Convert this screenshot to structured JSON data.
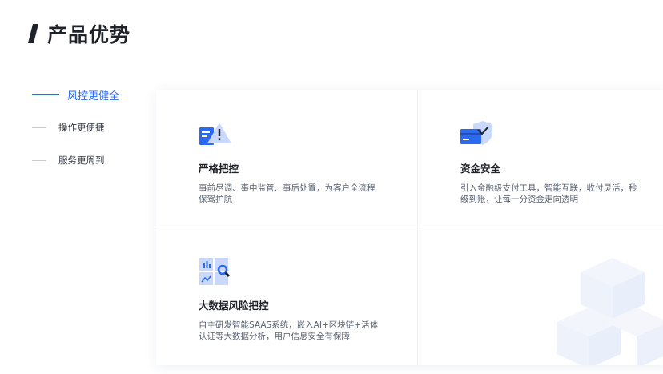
{
  "header": {
    "title": "产品优势"
  },
  "tabs": [
    {
      "label": "风控更健全",
      "active": true
    },
    {
      "label": "操作更便捷",
      "active": false
    },
    {
      "label": "服务更周到",
      "active": false
    }
  ],
  "cards": [
    {
      "icon": "document-warning-icon",
      "title": "严格把控",
      "desc": "事前尽调、事中监管、事后处置，为客户全流程保驾护航"
    },
    {
      "icon": "card-shield-icon",
      "title": "资金安全",
      "desc": "引入金融级支付工具，智能互联，收付灵活，秒级到账，让每一分资金走向透明"
    },
    {
      "icon": "data-search-icon",
      "title": "大数据风险把控",
      "desc": "自主研发智能SAAS系统，嵌入AI+区块链+活体认证等大数据分析，用户信息安全有保障"
    }
  ],
  "colors": {
    "accent": "#2a6af3",
    "icon_light": "#c9d8fb",
    "text_dark": "#1f2329",
    "text_muted": "#5a6170"
  }
}
